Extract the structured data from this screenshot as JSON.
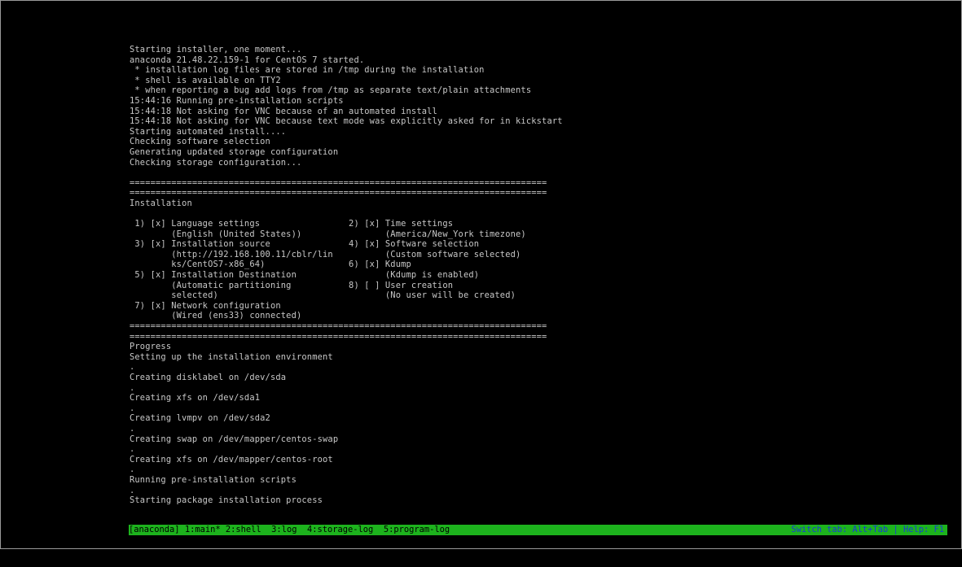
{
  "console": {
    "lines": [
      "Starting installer, one moment...",
      "anaconda 21.48.22.159-1 for CentOS 7 started.",
      " * installation log files are stored in /tmp during the installation",
      " * shell is available on TTY2",
      " * when reporting a bug add logs from /tmp as separate text/plain attachments",
      "15:44:16 Running pre-installation scripts",
      "15:44:18 Not asking for VNC because of an automated install",
      "15:44:18 Not asking for VNC because text mode was explicitly asked for in kickstart",
      "Starting automated install....",
      "Checking software selection",
      "Generating updated storage configuration",
      "Checking storage configuration...",
      "",
      "================================================================================",
      "================================================================================",
      "Installation",
      "",
      " 1) [x] Language settings                 2) [x] Time settings",
      "        (English (United States))                (America/New_York timezone)",
      " 3) [x] Installation source               4) [x] Software selection",
      "        (http://192.168.100.11/cblr/lin          (Custom software selected)",
      "        ks/CentOS7-x86_64)                6) [x] Kdump",
      " 5) [x] Installation Destination                 (Kdump is enabled)",
      "        (Automatic partitioning           8) [ ] User creation",
      "        selected)                                (No user will be created)",
      " 7) [x] Network configuration",
      "        (Wired (ens33) connected)",
      "================================================================================",
      "================================================================================",
      "Progress",
      "Setting up the installation environment",
      ".",
      "Creating disklabel on /dev/sda",
      ".",
      "Creating xfs on /dev/sda1",
      ".",
      "Creating lvmpv on /dev/sda2",
      ".",
      "Creating swap on /dev/mapper/centos-swap",
      ".",
      "Creating xfs on /dev/mapper/centos-root",
      ".",
      "Running pre-installation scripts",
      ".",
      "Starting package installation process"
    ]
  },
  "statusbar": {
    "tabs": [
      "[anaconda] 1:main* ",
      "2:shell  ",
      "3:log  ",
      "4:storage-log  ",
      "5:program-log"
    ],
    "hint": "Switch tab: Alt+Tab | Help: F1"
  },
  "colors": {
    "background": "#000000",
    "text": "#c8c8c8",
    "statusbar_bg": "#1db31d",
    "statusbar_text": "#000000",
    "hint_text": "#1a3ad6"
  }
}
